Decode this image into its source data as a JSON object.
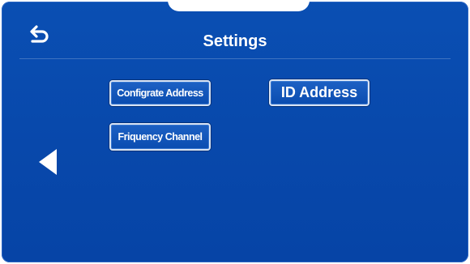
{
  "header": {
    "title": "Settings",
    "back_icon": "return-arrow-icon"
  },
  "buttons": {
    "configurate_address": "Configrate Address",
    "id_address": "ID Address",
    "frequency_channel": "Friquency Channel"
  },
  "nav": {
    "left_icon": "triangle-left-icon"
  },
  "colors": {
    "background": "#0848ab",
    "button_border": "#d8e3f4",
    "text": "#ffffff"
  }
}
